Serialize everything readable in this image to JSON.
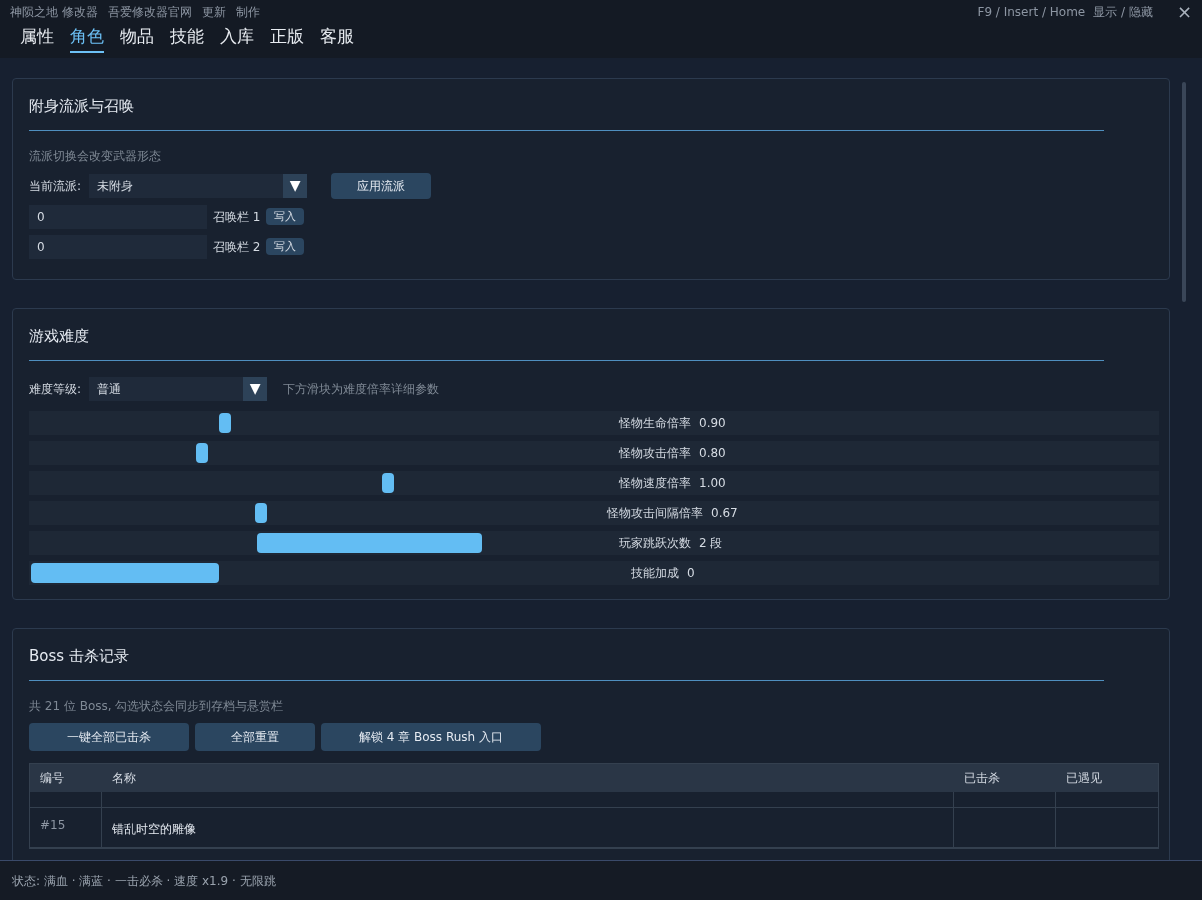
{
  "title_bar": {
    "menu": [
      "神陨之地 修改器",
      "吾爱修改器官网",
      "更新",
      "制作"
    ],
    "hotkey": "F9 / Insert / Home",
    "toggle": "显示 / 隐藏",
    "close": "×"
  },
  "tabs": [
    {
      "label": "属性",
      "selected": false
    },
    {
      "label": "角色",
      "selected": true
    },
    {
      "label": "物品",
      "selected": false
    },
    {
      "label": "技能",
      "selected": false
    },
    {
      "label": "入库",
      "selected": false
    },
    {
      "label": "正版",
      "selected": false
    },
    {
      "label": "客服",
      "selected": false
    }
  ],
  "possession": {
    "title": "附身流派与召唤",
    "hint": "流派切换会改变武器形态",
    "style_label": "当前流派:",
    "style_value": "未附身",
    "dropdown_arrow": "▼",
    "apply_button": "应用流派",
    "summon_slots": [
      {
        "value": "0",
        "label": "召唤栏 1",
        "button": "写入"
      },
      {
        "value": "0",
        "label": "召唤栏 2",
        "button": "写入"
      }
    ]
  },
  "difficulty": {
    "title": "游戏难度",
    "level_label": "难度等级:",
    "level_value": "普通",
    "dropdown_arrow": "▼",
    "hint": "下方滑块为难度倍率详细参数",
    "sliders": [
      {
        "kind": "thumb",
        "level": 0.168,
        "label": "怪物生命倍率",
        "reading": "0.90"
      },
      {
        "kind": "thumb",
        "level": 0.148,
        "label": "怪物攻击倍率",
        "reading": "0.80"
      },
      {
        "kind": "thumb",
        "level": 0.312,
        "label": "怪物速度倍率",
        "reading": "1.00"
      },
      {
        "kind": "thumb",
        "level": 0.2,
        "label": "怪物攻击间隔倍率",
        "reading": "0.67"
      },
      {
        "kind": "wide",
        "level": 0.202,
        "label": "玩家跳跃次数",
        "reading": "2 段"
      },
      {
        "kind": "fill",
        "level": 0.166,
        "label": "技能加成",
        "reading": "0"
      }
    ]
  },
  "boss": {
    "title": "Boss 击杀记录",
    "hint": "共 21 位 Boss, 勾选状态会同步到存档与悬赏栏",
    "buttons": [
      "一键全部已击杀",
      "全部重置",
      "解锁 4 章 Boss Rush 入口"
    ],
    "columns": [
      "编号",
      "名称",
      "已击杀",
      "已遇见"
    ],
    "rows": [
      {
        "id": "",
        "name": ""
      },
      {
        "id": "#15",
        "name": "错乱时空的雕像"
      }
    ]
  },
  "status_bar": "状态: 满血 · 满蓝 · 一击必杀 · 速度 x1.9 · 无限跳"
}
